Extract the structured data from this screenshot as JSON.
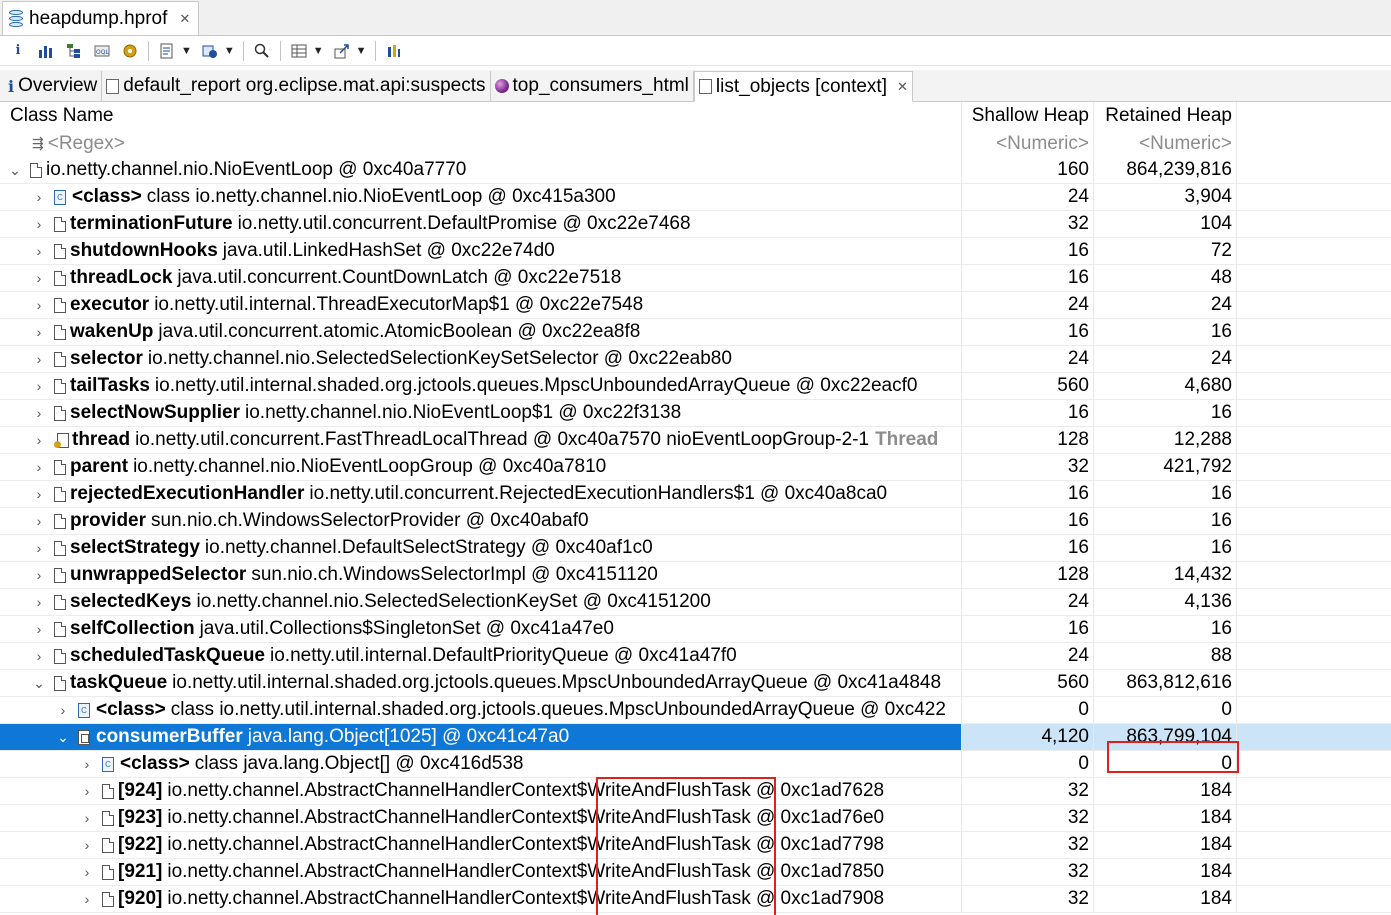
{
  "editor": {
    "tab_title": "heapdump.hprof",
    "tab_close": "✕"
  },
  "toolbar": {
    "buttons": [
      "info-icon",
      "histogram-icon",
      "dominator-tree-icon",
      "oql-icon",
      "thread-overview-icon",
      "run-report-icon",
      "query-browser-icon",
      "find-object-icon",
      "group-result-icon",
      "export-icon",
      "settings-icon"
    ]
  },
  "inner_tabs": [
    {
      "label": "Overview",
      "icon": "info-icon"
    },
    {
      "label": "default_report  org.eclipse.mat.api:suspects",
      "icon": "report-icon"
    },
    {
      "label": "top_consumers_html",
      "icon": "globe-icon"
    },
    {
      "label": "list_objects  [context]",
      "icon": "list-icon",
      "closable": true,
      "active": true
    }
  ],
  "table": {
    "headers": {
      "name": "Class Name",
      "shallow": "Shallow Heap",
      "retained": "Retained Heap"
    },
    "filters": {
      "name": "<Regex>",
      "shallow": "<Numeric>",
      "retained": "<Numeric>"
    },
    "rows": [
      {
        "level": 0,
        "twist": "expanded",
        "icon": "object",
        "field": "",
        "value": "io.netty.channel.nio.NioEventLoop @ 0xc40a7770",
        "tag": "",
        "shallow": "160",
        "retained": "864,239,816"
      },
      {
        "level": 1,
        "twist": "collapsed",
        "icon": "class",
        "field": "<class>",
        "value": "class io.netty.channel.nio.NioEventLoop @ 0xc415a300",
        "tag": "",
        "shallow": "24",
        "retained": "3,904"
      },
      {
        "level": 1,
        "twist": "collapsed",
        "icon": "object",
        "field": "terminationFuture",
        "value": "io.netty.util.concurrent.DefaultPromise @ 0xc22e7468",
        "tag": "",
        "shallow": "32",
        "retained": "104"
      },
      {
        "level": 1,
        "twist": "collapsed",
        "icon": "object",
        "field": "shutdownHooks",
        "value": "java.util.LinkedHashSet @ 0xc22e74d0",
        "tag": "",
        "shallow": "16",
        "retained": "72"
      },
      {
        "level": 1,
        "twist": "collapsed",
        "icon": "object",
        "field": "threadLock",
        "value": "java.util.concurrent.CountDownLatch @ 0xc22e7518",
        "tag": "",
        "shallow": "16",
        "retained": "48"
      },
      {
        "level": 1,
        "twist": "collapsed",
        "icon": "object",
        "field": "executor",
        "value": "io.netty.util.internal.ThreadExecutorMap$1 @ 0xc22e7548",
        "tag": "",
        "shallow": "24",
        "retained": "24"
      },
      {
        "level": 1,
        "twist": "collapsed",
        "icon": "object",
        "field": "wakenUp",
        "value": "java.util.concurrent.atomic.AtomicBoolean @ 0xc22ea8f8",
        "tag": "",
        "shallow": "16",
        "retained": "16"
      },
      {
        "level": 1,
        "twist": "collapsed",
        "icon": "object",
        "field": "selector",
        "value": "io.netty.channel.nio.SelectedSelectionKeySetSelector @ 0xc22eab80",
        "tag": "",
        "shallow": "24",
        "retained": "24"
      },
      {
        "level": 1,
        "twist": "collapsed",
        "icon": "object",
        "field": "tailTasks",
        "value": "io.netty.util.internal.shaded.org.jctools.queues.MpscUnboundedArrayQueue @ 0xc22eacf0",
        "tag": "",
        "shallow": "560",
        "retained": "4,680"
      },
      {
        "level": 1,
        "twist": "collapsed",
        "icon": "object",
        "field": "selectNowSupplier",
        "value": "io.netty.channel.nio.NioEventLoop$1 @ 0xc22f3138",
        "tag": "",
        "shallow": "16",
        "retained": "16"
      },
      {
        "level": 1,
        "twist": "collapsed",
        "icon": "thread",
        "field": "thread",
        "value": "io.netty.util.concurrent.FastThreadLocalThread @ 0xc40a7570  nioEventLoopGroup-2-1",
        "tag": "Thread",
        "shallow": "128",
        "retained": "12,288"
      },
      {
        "level": 1,
        "twist": "collapsed",
        "icon": "object",
        "field": "parent",
        "value": "io.netty.channel.nio.NioEventLoopGroup @ 0xc40a7810",
        "tag": "",
        "shallow": "32",
        "retained": "421,792"
      },
      {
        "level": 1,
        "twist": "collapsed",
        "icon": "object",
        "field": "rejectedExecutionHandler",
        "value": "io.netty.util.concurrent.RejectedExecutionHandlers$1 @ 0xc40a8ca0",
        "tag": "",
        "shallow": "16",
        "retained": "16"
      },
      {
        "level": 1,
        "twist": "collapsed",
        "icon": "object",
        "field": "provider",
        "value": "sun.nio.ch.WindowsSelectorProvider @ 0xc40abaf0",
        "tag": "",
        "shallow": "16",
        "retained": "16"
      },
      {
        "level": 1,
        "twist": "collapsed",
        "icon": "object",
        "field": "selectStrategy",
        "value": "io.netty.channel.DefaultSelectStrategy @ 0xc40af1c0",
        "tag": "",
        "shallow": "16",
        "retained": "16"
      },
      {
        "level": 1,
        "twist": "collapsed",
        "icon": "object",
        "field": "unwrappedSelector",
        "value": "sun.nio.ch.WindowsSelectorImpl @ 0xc4151120",
        "tag": "",
        "shallow": "128",
        "retained": "14,432"
      },
      {
        "level": 1,
        "twist": "collapsed",
        "icon": "object",
        "field": "selectedKeys",
        "value": "io.netty.channel.nio.SelectedSelectionKeySet @ 0xc4151200",
        "tag": "",
        "shallow": "24",
        "retained": "4,136"
      },
      {
        "level": 1,
        "twist": "collapsed",
        "icon": "object",
        "field": "selfCollection",
        "value": "java.util.Collections$SingletonSet @ 0xc41a47e0",
        "tag": "",
        "shallow": "16",
        "retained": "16"
      },
      {
        "level": 1,
        "twist": "collapsed",
        "icon": "object",
        "field": "scheduledTaskQueue",
        "value": "io.netty.util.internal.DefaultPriorityQueue @ 0xc41a47f0",
        "tag": "",
        "shallow": "24",
        "retained": "88"
      },
      {
        "level": 1,
        "twist": "expanded",
        "icon": "object",
        "field": "taskQueue",
        "value": "io.netty.util.internal.shaded.org.jctools.queues.MpscUnboundedArrayQueue @ 0xc41a4848",
        "tag": "",
        "shallow": "560",
        "retained": "863,812,616"
      },
      {
        "level": 2,
        "twist": "collapsed",
        "icon": "class",
        "field": "<class>",
        "value": "class io.netty.util.internal.shaded.org.jctools.queues.MpscUnboundedArrayQueue @ 0xc422",
        "tag": "",
        "shallow": "0",
        "retained": "0"
      },
      {
        "level": 2,
        "twist": "expanded",
        "icon": "array",
        "field": "consumerBuffer",
        "value": "java.lang.Object[1025] @ 0xc41c47a0",
        "tag": "",
        "shallow": "4,120",
        "retained": "863,799,104",
        "selected": true
      },
      {
        "level": 3,
        "twist": "collapsed",
        "icon": "class",
        "field": "<class>",
        "value": "class java.lang.Object[] @ 0xc416d538",
        "tag": "",
        "shallow": "0",
        "retained": "0"
      },
      {
        "level": 3,
        "twist": "collapsed",
        "icon": "object",
        "field": "[924]",
        "value": "io.netty.channel.AbstractChannelHandlerContext$WriteAndFlushTask @ 0xc1ad7628",
        "tag": "",
        "shallow": "32",
        "retained": "184"
      },
      {
        "level": 3,
        "twist": "collapsed",
        "icon": "object",
        "field": "[923]",
        "value": "io.netty.channel.AbstractChannelHandlerContext$WriteAndFlushTask @ 0xc1ad76e0",
        "tag": "",
        "shallow": "32",
        "retained": "184"
      },
      {
        "level": 3,
        "twist": "collapsed",
        "icon": "object",
        "field": "[922]",
        "value": "io.netty.channel.AbstractChannelHandlerContext$WriteAndFlushTask @ 0xc1ad7798",
        "tag": "",
        "shallow": "32",
        "retained": "184"
      },
      {
        "level": 3,
        "twist": "collapsed",
        "icon": "object",
        "field": "[921]",
        "value": "io.netty.channel.AbstractChannelHandlerContext$WriteAndFlushTask @ 0xc1ad7850",
        "tag": "",
        "shallow": "32",
        "retained": "184"
      },
      {
        "level": 3,
        "twist": "collapsed",
        "icon": "object",
        "field": "[920]",
        "value": "io.netty.channel.AbstractChannelHandlerContext$WriteAndFlushTask @ 0xc1ad7908",
        "tag": "",
        "shallow": "32",
        "retained": "184"
      }
    ]
  },
  "highlight_color": "#e0201e",
  "selection_color": "#0f78d7"
}
